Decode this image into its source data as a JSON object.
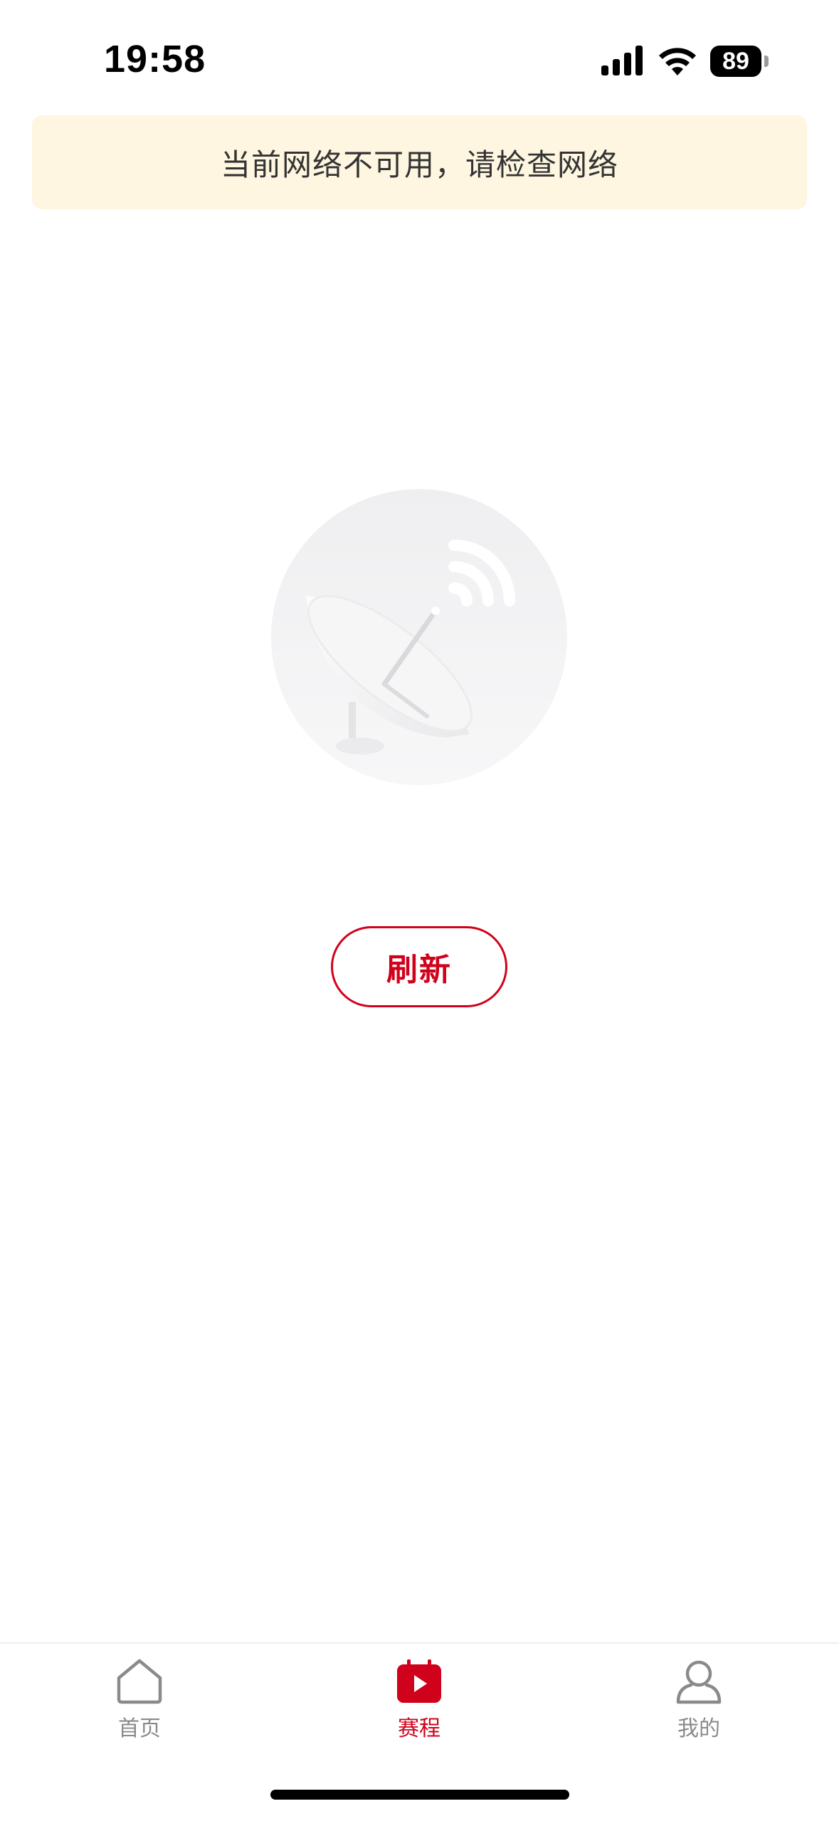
{
  "status_bar": {
    "time": "19:58",
    "battery_level": "89",
    "icons": [
      "cellular-signal-icon",
      "wifi-icon",
      "battery-icon"
    ]
  },
  "banner": {
    "message": "当前网络不可用，请检查网络",
    "background_color": "#fef6e0"
  },
  "empty_state": {
    "illustration": "satellite-dish-icon",
    "refresh_label": "刷新"
  },
  "tab_bar": {
    "active_index": 1,
    "items": [
      {
        "label": "首页",
        "icon": "home-icon",
        "active": false
      },
      {
        "label": "赛程",
        "icon": "schedule-play-icon",
        "active": true
      },
      {
        "label": "我的",
        "icon": "user-icon",
        "active": false
      }
    ]
  },
  "colors": {
    "accent": "#d0021b",
    "inactive": "#8a8a8a"
  }
}
